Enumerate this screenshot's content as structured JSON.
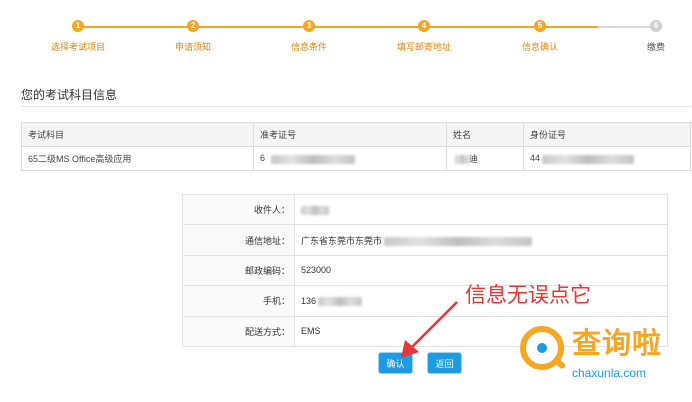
{
  "steps": [
    {
      "num": "1",
      "label": "选择考试项目",
      "status": "done"
    },
    {
      "num": "2",
      "label": "申请须知",
      "status": "done"
    },
    {
      "num": "3",
      "label": "信息条件",
      "status": "done"
    },
    {
      "num": "4",
      "label": "填写邮寄地址",
      "status": "done"
    },
    {
      "num": "5",
      "label": "信息确认",
      "status": "current"
    },
    {
      "num": "6",
      "label": "缴费",
      "status": "pending"
    }
  ],
  "subject_section": {
    "title": "您的考试科目信息",
    "columns": [
      "考试科目",
      "准考证号",
      "姓名",
      "身份证号"
    ],
    "row": {
      "subject": "65二级MS Office高级应用",
      "exam_id": "6",
      "name": "迪",
      "id_number": "44"
    }
  },
  "address_section": {
    "recipient_label": "收件人：",
    "recipient_value": "",
    "address_label": "通信地址：",
    "address_value": "广东省东莞市东莞市",
    "postcode_label": "邮政编码：",
    "postcode_value": "523000",
    "phone_label": "手机：",
    "phone_value": "136",
    "delivery_label": "配送方式：",
    "delivery_value": "EMS"
  },
  "buttons": {
    "confirm": "确认",
    "back": "返回"
  },
  "annotation": "信息无误点它",
  "watermark": {
    "name": "查询啦",
    "url": "chaxunla.com"
  },
  "colors": {
    "accent": "#f5a623",
    "button": "#1e9be0",
    "annotation": "#e8363a"
  }
}
